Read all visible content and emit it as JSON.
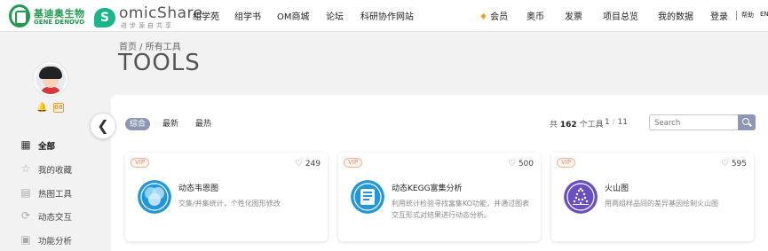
{
  "header": {
    "logo_cn": "基迪奥生物",
    "logo_en": "GENE DENOVO",
    "brand": "omicShare",
    "brand_mark": "S",
    "brand_sub": "进步源自共享",
    "nav": [
      "组学苑",
      "组学书",
      "OM商城",
      "论坛",
      "科研协作网站"
    ],
    "member": "会员",
    "links": [
      "奥币",
      "发票",
      "项目总览",
      "我的数据",
      "登录"
    ],
    "help": "帮助",
    "lang": "EN"
  },
  "sidebar": {
    "badge": "08",
    "items": [
      {
        "label": "全部",
        "icon": "grid-icon"
      },
      {
        "label": "我的收藏",
        "icon": "star-icon"
      },
      {
        "label": "热图工具",
        "icon": "heatmap-icon"
      },
      {
        "label": "动态交互",
        "icon": "interactive-icon"
      },
      {
        "label": "功能分析",
        "icon": "analysis-icon"
      }
    ]
  },
  "main": {
    "breadcrumb": "首页 / 所有工具",
    "title": "TOOLS",
    "tabs": [
      "综合",
      "最新",
      "最热"
    ],
    "count_prefix": "共",
    "count_value": "162",
    "count_suffix": "个工具",
    "page_current": "1",
    "page_sep": "/",
    "page_total": "11",
    "search_placeholder": "Search",
    "cards": [
      {
        "vip": "VIP",
        "likes": "249",
        "name": "动态韦恩图",
        "desc": "交集/并集统计，个性化图形修改",
        "color": "#2196d8"
      },
      {
        "vip": "VIP",
        "likes": "500",
        "name": "动态KEGG富集分析",
        "desc": "利用统计检验寻找富集KO功能，并通过图表交互形式对结果进行动态分析。",
        "color": "#2196d8"
      },
      {
        "vip": "VIP",
        "likes": "595",
        "name": "火山图",
        "desc": "用两组样品间的差异基因绘制火山图",
        "color": "#6a4fc2"
      }
    ]
  }
}
